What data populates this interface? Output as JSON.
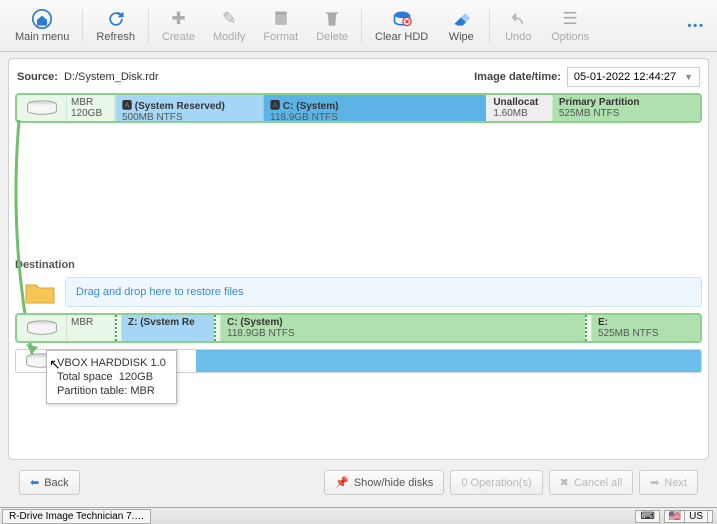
{
  "toolbar": {
    "main_menu": "Main menu",
    "refresh": "Refresh",
    "create": "Create",
    "modify": "Modify",
    "format": "Format",
    "delete": "Delete",
    "clear_hdd": "Clear HDD",
    "wipe": "Wipe",
    "undo": "Undo",
    "options": "Options",
    "more": "•••"
  },
  "source": {
    "label": "Source:",
    "path": "D:/System_Disk.rdr",
    "dt_label": "Image date/time:",
    "dt_value": "05-01-2022 12:44:27",
    "disk": {
      "scheme": "MBR",
      "size": "120GB",
      "parts": [
        {
          "name": "(System Reserved)",
          "detail": "500MB NTFS",
          "cls": "p-sys",
          "flex": 18
        },
        {
          "name": "C: (System)",
          "detail": "118.9GB NTFS",
          "cls": "p-c",
          "flex": 28
        },
        {
          "name": "Unallocat",
          "detail": "1.60MB",
          "cls": "p-unalloc",
          "flex": 7
        },
        {
          "name": "Primary Partition",
          "detail": "525MB NTFS",
          "cls": "p-prim",
          "flex": 18
        }
      ]
    }
  },
  "dest": {
    "label": "Destination",
    "drop_hint": "Drag and drop here to restore files",
    "disk": {
      "scheme": "MBR",
      "parts": [
        {
          "name": "Z: (Svstem Re",
          "detail": "",
          "cls": "p-sys",
          "flex": 10
        },
        {
          "name": "C: (System)",
          "detail": "118.9GB NTFS",
          "cls": "p-prim",
          "flex": 44
        },
        {
          "name": "E:",
          "detail": "525MB NTFS",
          "cls": "p-prim",
          "flex": 12
        }
      ]
    }
  },
  "tooltip": {
    "title": "VBOX HARDDISK 1.0",
    "total_label": "Total space",
    "total_value": "120GB",
    "pt_label": "Partition table:",
    "pt_value": "MBR"
  },
  "footer": {
    "back": "Back",
    "showhide": "Show/hide disks",
    "ops": "0 Operation(s)",
    "cancel": "Cancel all",
    "next": "Next"
  },
  "taskbar": {
    "app": "R-Drive Image Technician 7.…",
    "lang": "US"
  }
}
